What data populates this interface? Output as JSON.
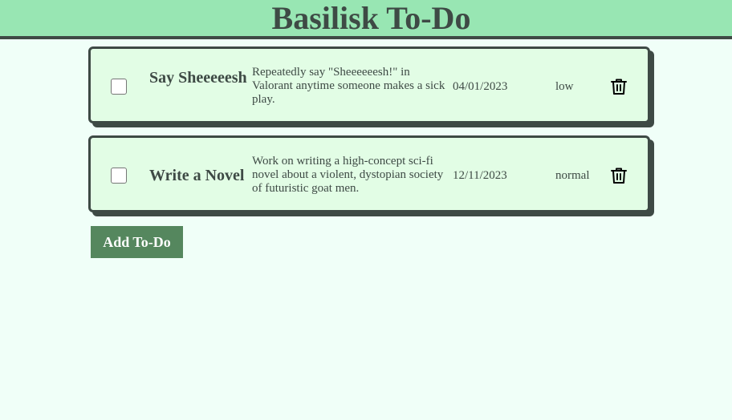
{
  "app": {
    "title": "Basilisk To-Do"
  },
  "todos": [
    {
      "checked": false,
      "title": "Say Sheeeeesh",
      "description": "Repeatedly say \"Sheeeeeesh!\" in Valorant anytime someone makes a sick play.",
      "date": "04/01/2023",
      "priority": "low",
      "delete_icon": "trash-icon"
    },
    {
      "checked": false,
      "title": "Write a Novel",
      "description": "Work on writing a high-concept sci-fi novel about a violent, dystopian society of futuristic goat men.",
      "date": "12/11/2023",
      "priority": "normal",
      "delete_icon": "trash-icon"
    }
  ],
  "actions": {
    "add_label": "Add To-Do"
  },
  "colors": {
    "background": "#f0fff8",
    "header": "#98e6b3",
    "card": "#e2fde5",
    "border": "#3e4a45",
    "button": "#55875e"
  }
}
